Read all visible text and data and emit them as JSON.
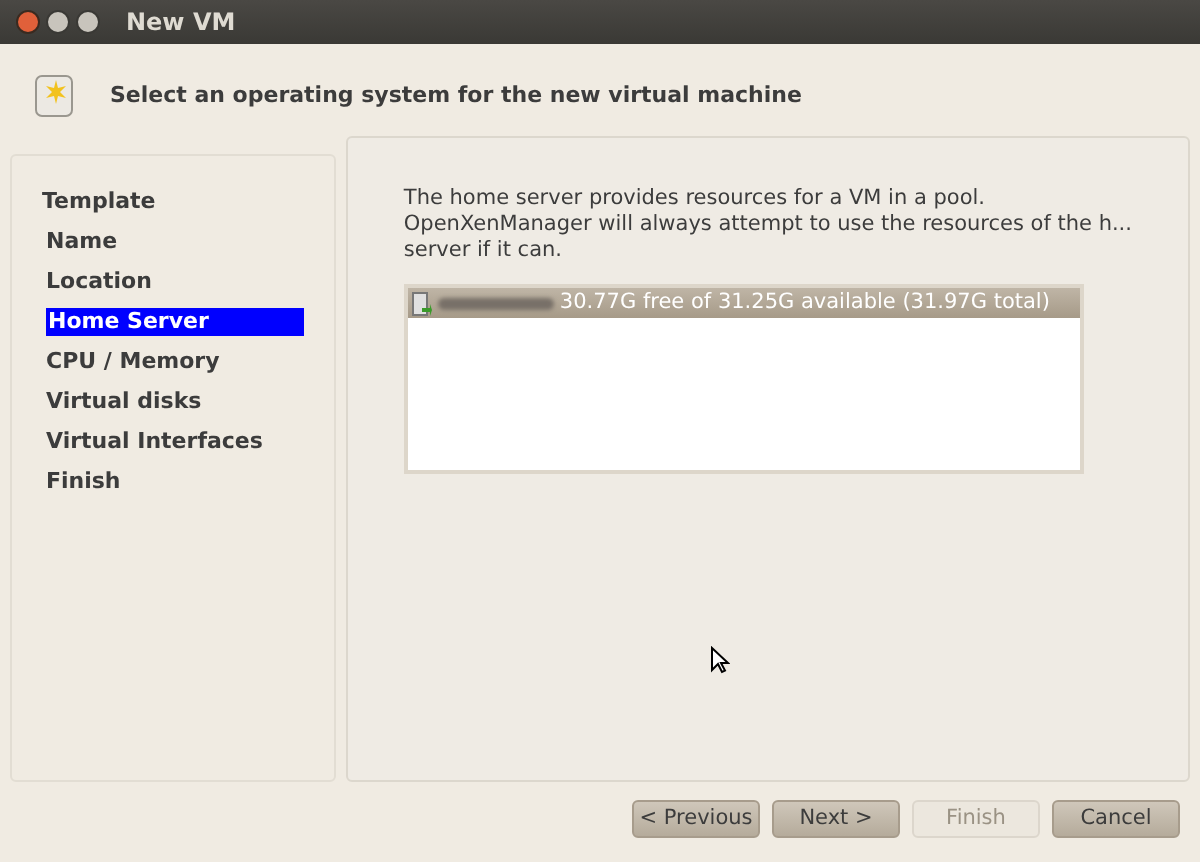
{
  "window": {
    "title": "New VM"
  },
  "header": {
    "text": "Select an operating system for the new virtual machine"
  },
  "steps": [
    {
      "label": "Template",
      "kind": "header",
      "selected": false
    },
    {
      "label": "Name",
      "kind": "step",
      "selected": false
    },
    {
      "label": "Location",
      "kind": "step",
      "selected": false
    },
    {
      "label": "Home Server",
      "kind": "step",
      "selected": true
    },
    {
      "label": "CPU / Memory",
      "kind": "step",
      "selected": false
    },
    {
      "label": "Virtual disks",
      "kind": "step",
      "selected": false
    },
    {
      "label": "Virtual Interfaces",
      "kind": "step",
      "selected": false
    },
    {
      "label": "Finish",
      "kind": "step",
      "selected": false
    }
  ],
  "description": [
    "The home server provides resources for a VM in a pool.",
    "OpenXenManager will always attempt to use the resources of the h...",
    "server if it can."
  ],
  "servers": [
    {
      "info": "30.77G free of 31.25G available (31.97G total)",
      "selected": true
    }
  ],
  "buttons": [
    {
      "label": "< Previous",
      "disabled": false
    },
    {
      "label": "Next >",
      "disabled": false
    },
    {
      "label": "Finish",
      "disabled": true
    },
    {
      "label": "Cancel",
      "disabled": false
    }
  ]
}
